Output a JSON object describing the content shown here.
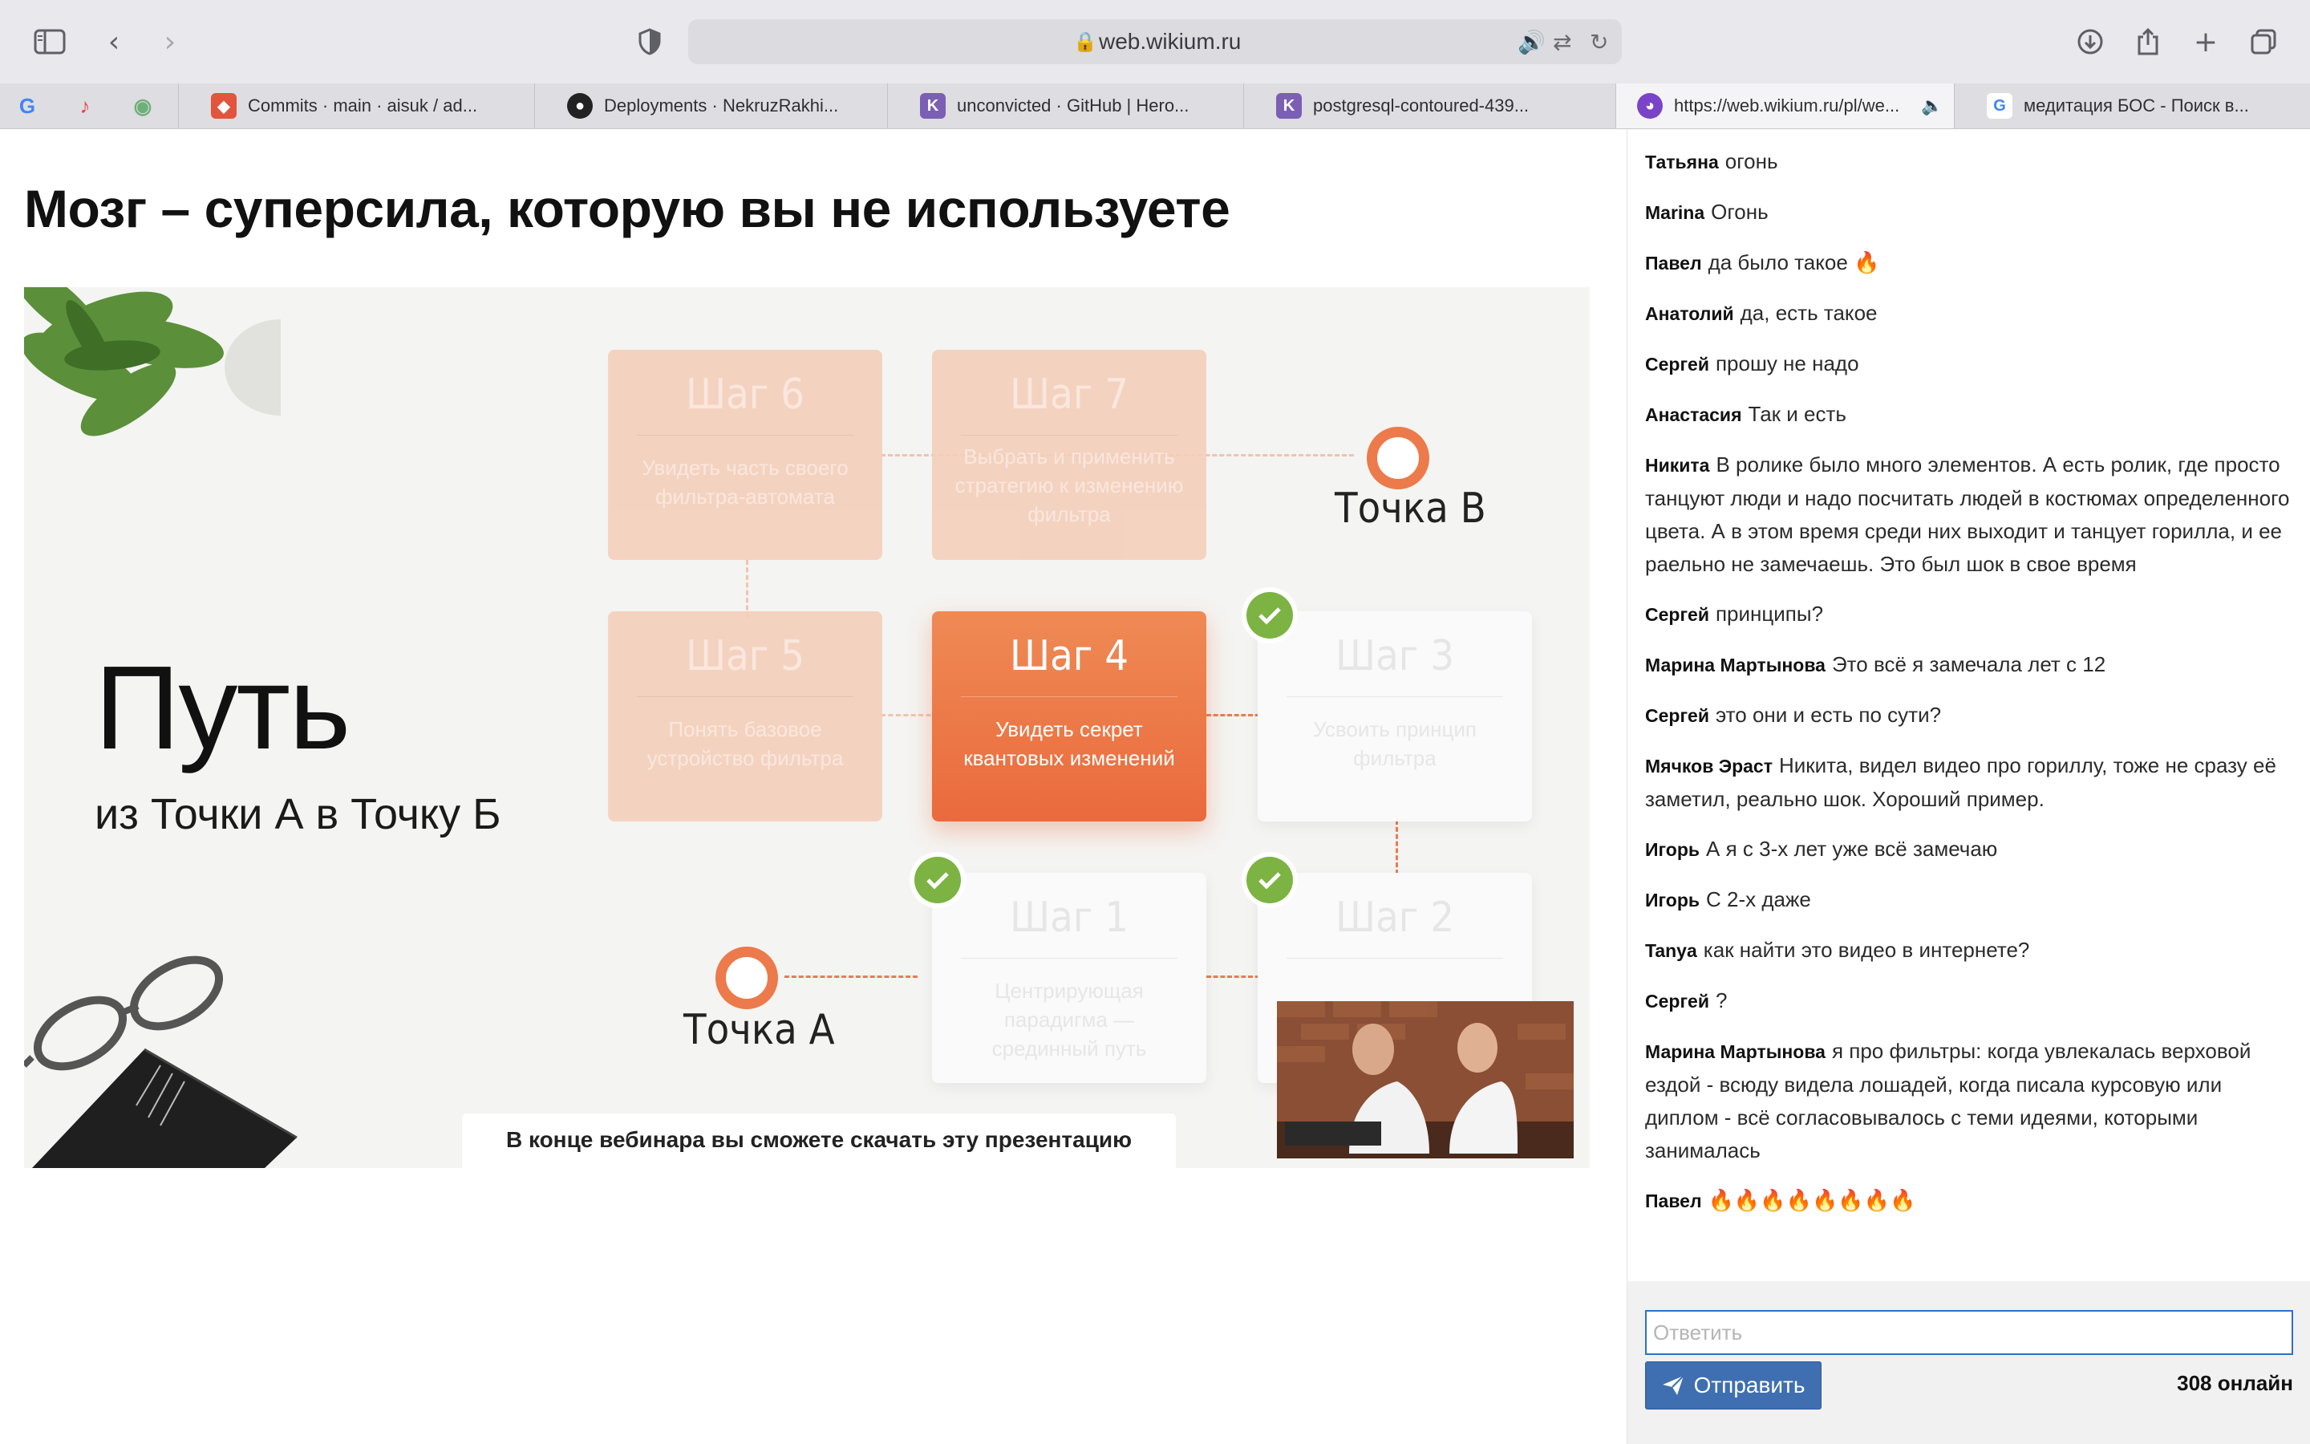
{
  "browser": {
    "url": "web.wikium.ru",
    "pinned": [
      {
        "icon": "google-icon",
        "glyph": "G",
        "color": "#4285f4"
      },
      {
        "icon": "tiktok-icon",
        "glyph": "♪",
        "color": "#e8454f"
      },
      {
        "icon": "app-icon",
        "glyph": "◉",
        "color": "#6fb07a"
      }
    ],
    "tabs": [
      {
        "title": "Commits · main · aisuk / ad...",
        "icon": "gitlab-icon",
        "color": "#e2543c",
        "glyph": "◆"
      },
      {
        "title": "Deployments · NekruzRakhi...",
        "icon": "github-icon",
        "color": "#222222",
        "glyph": "●"
      },
      {
        "title": "unconvicted · GitHub | Hero...",
        "icon": "heroku-icon",
        "color": "#7b5fb4",
        "glyph": "K"
      },
      {
        "title": "postgresql-contoured-439...",
        "icon": "heroku-icon",
        "color": "#7b5fb4",
        "glyph": "K"
      },
      {
        "title": "https://web.wikium.ru/pl/we...",
        "icon": "wikium-icon",
        "color": "#7a43c8",
        "glyph": "◕"
      },
      {
        "title": "медитация БОС - Поиск в...",
        "icon": "google-icon",
        "color": "#ffffff",
        "glyph": "G"
      }
    ]
  },
  "page": {
    "title": "Мозг – суперсила, которую вы не используете"
  },
  "slide": {
    "heading": "Путь",
    "subheading": "из Точки А в Точку Б",
    "point_a": "Точка А",
    "point_b": "Точка В",
    "note": "В конце вебинара вы сможете скачать эту презентацию",
    "steps": [
      {
        "title": "Шаг 6",
        "desc": "Увидеть часть своего фильтра-автомата"
      },
      {
        "title": "Шаг 7",
        "desc": "Выбрать и применить стратегию к изменению фильтра"
      },
      {
        "title": "Шаг 5",
        "desc": "Понять базовое устройство фильтра"
      },
      {
        "title": "Шаг 4",
        "desc": "Увидеть секрет квантовых изменений"
      },
      {
        "title": "Шаг 3",
        "desc": "Усвоить принцип фильтра"
      },
      {
        "title": "Шаг 1",
        "desc": "Центрирующая парадигма — срединный путь"
      },
      {
        "title": "Шаг 2",
        "desc": ""
      }
    ]
  },
  "chat": {
    "messages": [
      {
        "author": "Татьяна",
        "text": "огонь"
      },
      {
        "author": "Marina",
        "text": "Огонь"
      },
      {
        "author": "Павел",
        "text": "да было такое 🔥"
      },
      {
        "author": "Анатолий",
        "text": "да, есть такое"
      },
      {
        "author": "Сергей",
        "text": "прошу не надо"
      },
      {
        "author": "Анастасия",
        "text": "Так и есть"
      },
      {
        "author": "Никита",
        "text": "В ролике было много элементов. А есть ролик, где просто танцуют люди и надо посчитать людей в костюмах определенного цвета. А в этом время среди них выходит и танцует горилла, и ее раельно не замечаешь. Это был шок в свое время"
      },
      {
        "author": "Сергей",
        "text": "принципы?"
      },
      {
        "author": "Марина Мартынова",
        "text": "Это всё я замечала лет с 12"
      },
      {
        "author": "Сергей",
        "text": "это они и есть по сути?"
      },
      {
        "author": "Мячков Эраст",
        "text": "Никита, видел видео про гориллу, тоже не сразу её заметил, реально шок. Хороший пример."
      },
      {
        "author": "Игорь",
        "text": "А я с 3-х лет уже всё замечаю"
      },
      {
        "author": "Игорь",
        "text": "С 2-х даже"
      },
      {
        "author": "Tanya",
        "text": "как найти это видео в интернете?"
      },
      {
        "author": "Сергей",
        "text": "?"
      },
      {
        "author": "Марина Мартынова",
        "text": "я про фильтры: когда увлекалась верховой ездой - всюду видела лошадей, когда писала курсовую или диплом - всё согласовывалось с теми идеями, которыми занималась"
      },
      {
        "author": "Павел",
        "text": "🔥🔥🔥🔥🔥🔥🔥🔥"
      }
    ],
    "reply_placeholder": "Ответить",
    "send_label": "Отправить",
    "online": "308 онлайн"
  }
}
